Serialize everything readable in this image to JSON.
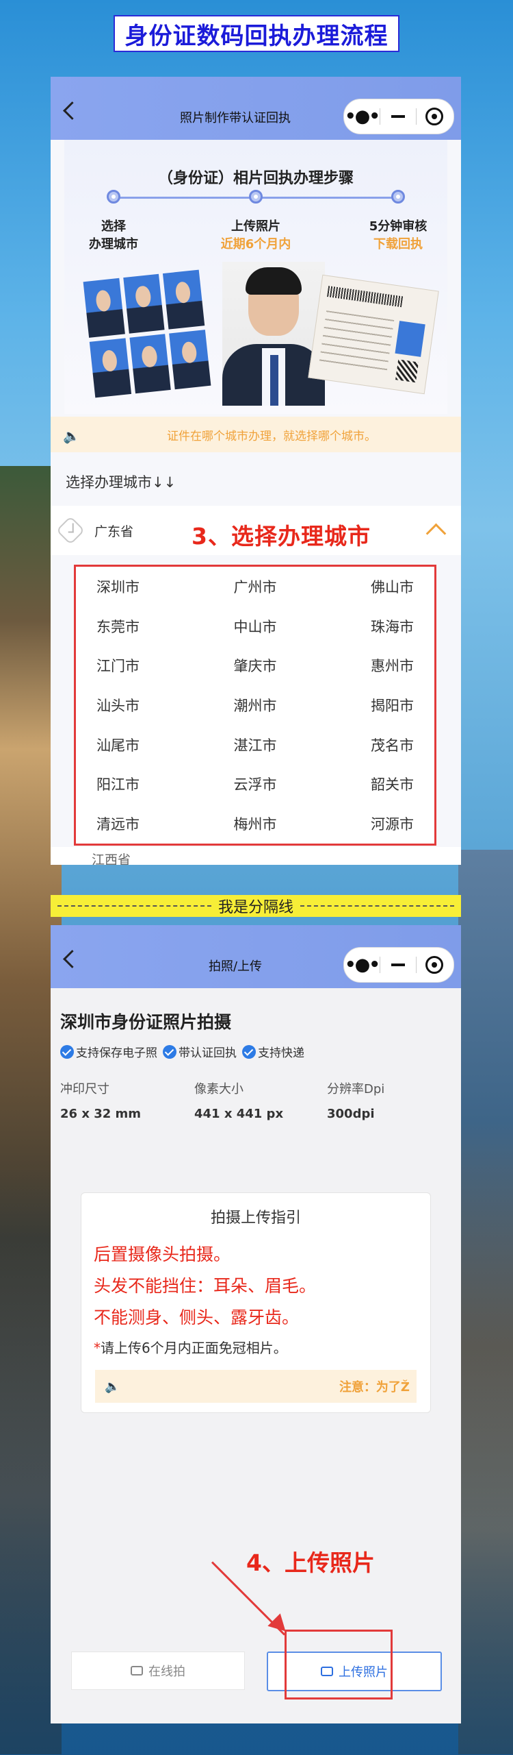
{
  "banner": {
    "title": "身份证数码回执办理流程"
  },
  "phone1": {
    "nav_title": "照片制作带认证回执",
    "steps_heading": "（身份证）相片回执办理步骤",
    "steps": [
      {
        "line1": "选择",
        "line2": "办理城市"
      },
      {
        "line1": "上传照片",
        "line2": "近期6个月内"
      },
      {
        "line1": "5分钟审核",
        "line2": "下载回执"
      }
    ],
    "notice": "证件在哪个城市办理，就选择哪个城市。",
    "choose_label": "选择办理城市↓↓",
    "province": "广东省",
    "annotation": "3、选择办理城市",
    "cities": [
      "深圳市",
      "广州市",
      "佛山市",
      "东莞市",
      "中山市",
      "珠海市",
      "江门市",
      "肇庆市",
      "惠州市",
      "汕头市",
      "潮州市",
      "揭阳市",
      "汕尾市",
      "湛江市",
      "茂名市",
      "阳江市",
      "云浮市",
      "韶关市",
      "清远市",
      "梅州市",
      "河源市"
    ],
    "next_province": "江西省"
  },
  "divider": {
    "text": "我是分隔线"
  },
  "phone2": {
    "nav_title": "拍照/上传",
    "title": "深圳市身份证照片拍摄",
    "tags": [
      "支持保存电子照",
      "带认证回执",
      "支持快递"
    ],
    "specs": [
      {
        "label": "冲印尺寸",
        "value": "26 x 32 mm"
      },
      {
        "label": "像素大小",
        "value": "441 x 441 px"
      },
      {
        "label": "分辨率Dpi",
        "value": "300dpi"
      }
    ],
    "guide": {
      "title": "拍摄上传指引",
      "rules": [
        "后置摄像头拍摄。",
        "头发不能挡住：耳朵、眉毛。",
        "不能测身、侧头、露牙齿。"
      ],
      "note": "请上传6个月内正面免冠相片。",
      "warn": "注意：为了Ž"
    },
    "annotation": "4、上传照片",
    "btn_online": "在线拍",
    "btn_upload": "上传照片"
  },
  "colors": {
    "accent": "#8aa5ef",
    "warning": "#f0a23a",
    "annotation": "#e8281b",
    "primary": "#2d6fe0"
  }
}
